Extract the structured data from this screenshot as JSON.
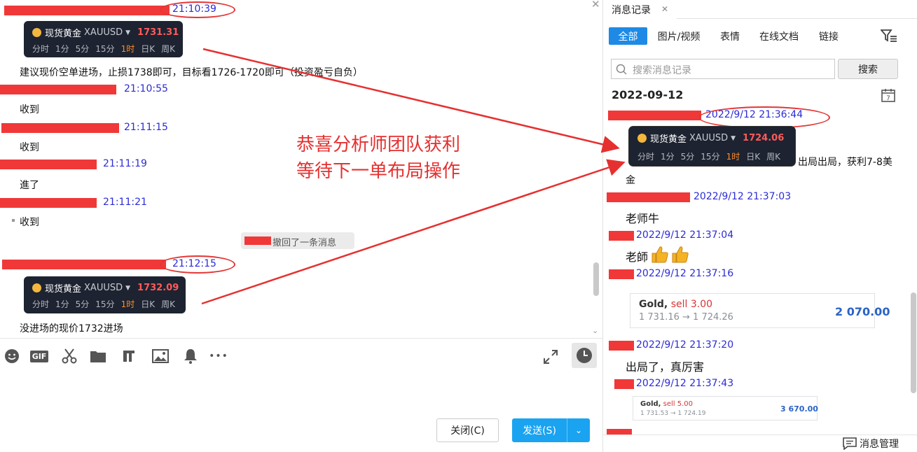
{
  "left": {
    "timestamps": [
      "21:10:39",
      "21:10:55",
      "21:11:15",
      "21:11:19",
      "21:11:21",
      "21:12:15"
    ],
    "messages": [
      "建议现价空单进场，止损1738即可，目标看1726-1720即可（投资盈亏自负）",
      "收到",
      "收到",
      "進了",
      "收到",
      "没进场的现价1732进场"
    ],
    "recall_text": "撤回了一条消息",
    "card1": {
      "name": "现货黄金",
      "symbol": "XAUUSD",
      "price": "1731.31"
    },
    "card2": {
      "name": "现货黄金",
      "symbol": "XAUUSD",
      "price": "1732.09"
    },
    "intervals": [
      "分时",
      "1分",
      "5分",
      "15分",
      "1时",
      "日K",
      "周K"
    ],
    "annotation_line1": "恭喜分析师团队获利",
    "annotation_line2": "等待下一单布局操作",
    "toolbar": {
      "gif": "GIF",
      "more": "•••"
    },
    "close_button": "关闭(C)",
    "send_button": "发送(S)"
  },
  "right": {
    "tab_title": "消息记录",
    "filters": [
      "全部",
      "图片/视频",
      "表情",
      "在线文档",
      "链接"
    ],
    "search_placeholder": "搜索消息记录",
    "search_button": "搜索",
    "date": "2022-09-12",
    "timestamps": [
      "2022/9/12 21:36:44",
      "2022/9/12 21:37:03",
      "2022/9/12 21:37:04",
      "2022/9/12 21:37:16",
      "2022/9/12 21:37:20",
      "2022/9/12 21:37:43"
    ],
    "card": {
      "name": "现货黄金",
      "symbol": "XAUUSD",
      "price": "1724.06"
    },
    "msg_after_card_1": "出局出局，获利7-8美",
    "msg_after_card_2": "金",
    "msg_laoshi_niu": "老师牛",
    "msg_laoshi": "老師",
    "msg_chuju": "出局了，真厉害",
    "trade1": {
      "title": "Gold,",
      "side": "sell 3.00",
      "prices": "1 731.16 → 1 724.26",
      "amount": "2 070.00"
    },
    "trade2": {
      "title": "Gold,",
      "side": "sell 5.00",
      "prices": "1 731.53 → 1 724.19",
      "amount": "3 670.00"
    },
    "manage_label": "消息管理"
  },
  "colors": {
    "accent": "#1aa3f0",
    "timestamp": "#2b2bd6",
    "redaction": "#f03838",
    "annotation": "#e63030",
    "card_bg": "#1d2330"
  }
}
